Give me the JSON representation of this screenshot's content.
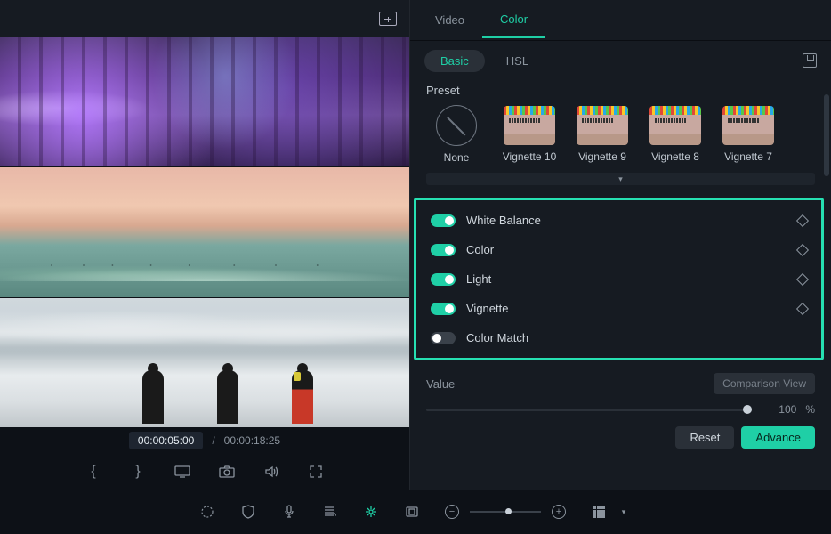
{
  "tabs": {
    "video": "Video",
    "color": "Color"
  },
  "subtabs": {
    "basic": "Basic",
    "hsl": "HSL"
  },
  "preset": {
    "label": "Preset",
    "items": [
      {
        "label": "None"
      },
      {
        "label": "Vignette 10"
      },
      {
        "label": "Vignette 9"
      },
      {
        "label": "Vignette 8"
      },
      {
        "label": "Vignette 7"
      }
    ]
  },
  "adjust": {
    "white_balance": "White Balance",
    "color": "Color",
    "light": "Light",
    "vignette": "Vignette",
    "color_match": "Color Match"
  },
  "value": {
    "label": "Value",
    "comparison": "Comparison View",
    "num": "100",
    "pct": "%"
  },
  "buttons": {
    "reset": "Reset",
    "advance": "Advance"
  },
  "time": {
    "current": "00:00:05:00",
    "sep": "/",
    "total": "00:00:18:25"
  }
}
